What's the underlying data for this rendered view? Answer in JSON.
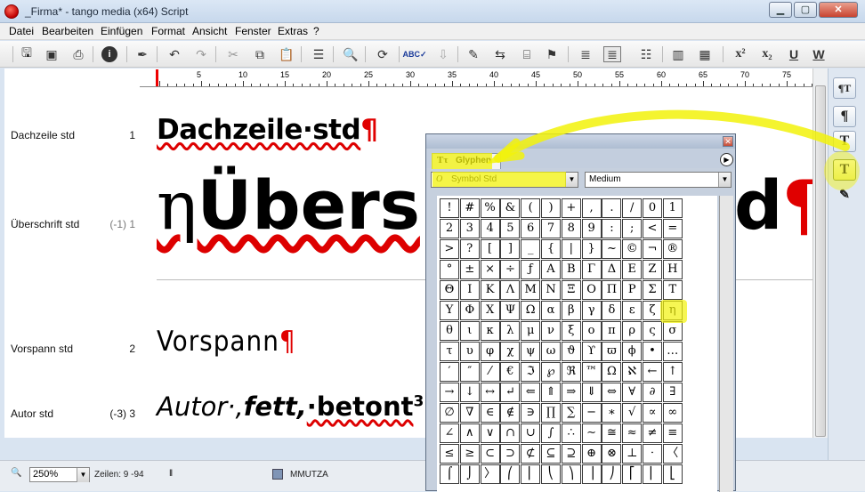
{
  "window": {
    "title": "_Firma* - tango media (x64) Script",
    "btn_min": "▁",
    "btn_max": "▢",
    "btn_close": "✕"
  },
  "menu": [
    "Datei",
    "Bearbeiten",
    "Einfügen",
    "Format",
    "Ansicht",
    "Fenster",
    "Extras",
    "?"
  ],
  "toolbar": {
    "superscript": "x²",
    "subscript": "x₂",
    "underline": "U",
    "word": "W"
  },
  "ruler": {
    "labels": [
      "5",
      "10",
      "15",
      "20",
      "25",
      "30",
      "35",
      "40",
      "45",
      "50",
      "55",
      "60",
      "65",
      "70",
      "75"
    ]
  },
  "styles": [
    {
      "name": "Dachzeile std",
      "num": "1"
    },
    {
      "name": "Überschrift std",
      "num": "(-1) 1"
    },
    {
      "name": "Vorspann std",
      "num": "2"
    },
    {
      "name": "Autor std",
      "num": "(-3) 3"
    }
  ],
  "doc": {
    "dachzeile": "Dachzeile·std",
    "pilcrow": "¶",
    "eta": "η",
    "ueberschrift": "Übers",
    "ueberschrift_end": "d",
    "vorspann": "Vorspann",
    "autor_a": "Autor·,",
    "autor_b": "fett,",
    "autor_c": "·betont",
    "autor_sup": "3"
  },
  "status": {
    "zoom": "250%",
    "zeilen": "Zeilen: 9 -94",
    "user": "MMUTZA"
  },
  "glyph": {
    "title": "Glyphen",
    "font": "Symbol Std",
    "style": "Medium",
    "rows": [
      [
        "!",
        "#",
        "%",
        "&",
        "(",
        ")",
        "+",
        ",",
        ".",
        "/",
        "0",
        "1"
      ],
      [
        "2",
        "3",
        "4",
        "5",
        "6",
        "7",
        "8",
        "9",
        ":",
        ";",
        "<",
        "="
      ],
      [
        ">",
        "?",
        "[",
        "]",
        "_",
        "{",
        "|",
        "}",
        "~",
        "©",
        "¬",
        "®"
      ],
      [
        "°",
        "±",
        "×",
        "÷",
        "ƒ",
        "Α",
        "Β",
        "Γ",
        "Δ",
        "Ε",
        "Ζ",
        "Η"
      ],
      [
        "Θ",
        "Ι",
        "Κ",
        "Λ",
        "Μ",
        "Ν",
        "Ξ",
        "Ο",
        "Π",
        "Ρ",
        "Σ",
        "Τ"
      ],
      [
        "Υ",
        "Φ",
        "Χ",
        "Ψ",
        "Ω",
        "α",
        "β",
        "γ",
        "δ",
        "ε",
        "ζ",
        "η"
      ],
      [
        "θ",
        "ι",
        "κ",
        "λ",
        "μ",
        "ν",
        "ξ",
        "ο",
        "π",
        "ρ",
        "ς",
        "σ"
      ],
      [
        "τ",
        "υ",
        "φ",
        "χ",
        "ψ",
        "ω",
        "ϑ",
        "ϒ",
        "ϖ",
        "ϕ",
        "•",
        "…"
      ],
      [
        "′",
        "″",
        "⁄",
        "€",
        "ℑ",
        "℘",
        "ℜ",
        "™",
        "Ω",
        "ℵ",
        "←",
        "↑"
      ],
      [
        "→",
        "↓",
        "↔",
        "↵",
        "⇐",
        "⇑",
        "⇒",
        "⇓",
        "⇔",
        "∀",
        "∂",
        "∃"
      ],
      [
        "∅",
        "∇",
        "∈",
        "∉",
        "∋",
        "∏",
        "∑",
        "−",
        "∗",
        "√",
        "∝",
        "∞"
      ],
      [
        "∠",
        "∧",
        "∨",
        "∩",
        "∪",
        "∫",
        "∴",
        "∼",
        "≅",
        "≈",
        "≠",
        "≡"
      ],
      [
        "≤",
        "≥",
        "⊂",
        "⊃",
        "⊄",
        "⊆",
        "⊇",
        "⊕",
        "⊗",
        "⊥",
        "⋅",
        "〈"
      ],
      [
        "⌠",
        "⌡",
        "〉",
        "⎛",
        "⎜",
        "⎝",
        "⎞",
        "⎟",
        "⎠",
        "⎡",
        "⎢",
        "⎣"
      ]
    ]
  },
  "right_palette": [
    "¶T",
    "¶",
    "T",
    "T",
    "✎"
  ],
  "colors": {
    "highlight": "#f2f20a",
    "pilcrow": "#e00000"
  }
}
